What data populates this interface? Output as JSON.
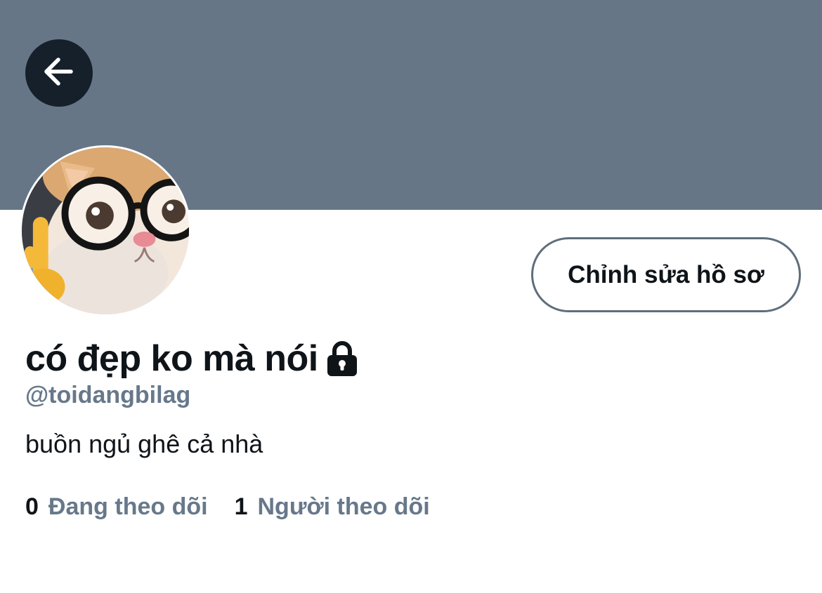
{
  "colors": {
    "banner": "#667686",
    "back_button_bg": "#15202b",
    "accent_text": "#67788a",
    "primary_text": "#0f1419"
  },
  "header": {
    "back_icon": "arrow-left-icon"
  },
  "profile": {
    "edit_button_label": "Chỉnh sửa hồ sơ",
    "display_name": "có đẹp ko mà nói",
    "lock_icon": "lock-icon",
    "handle": "@toidangbilag",
    "bio": "buồn ngủ ghê cả nhà"
  },
  "stats": {
    "following_count": "0",
    "following_label": "Đang theo dõi",
    "followers_count": "1",
    "followers_label": "Người theo dõi"
  }
}
